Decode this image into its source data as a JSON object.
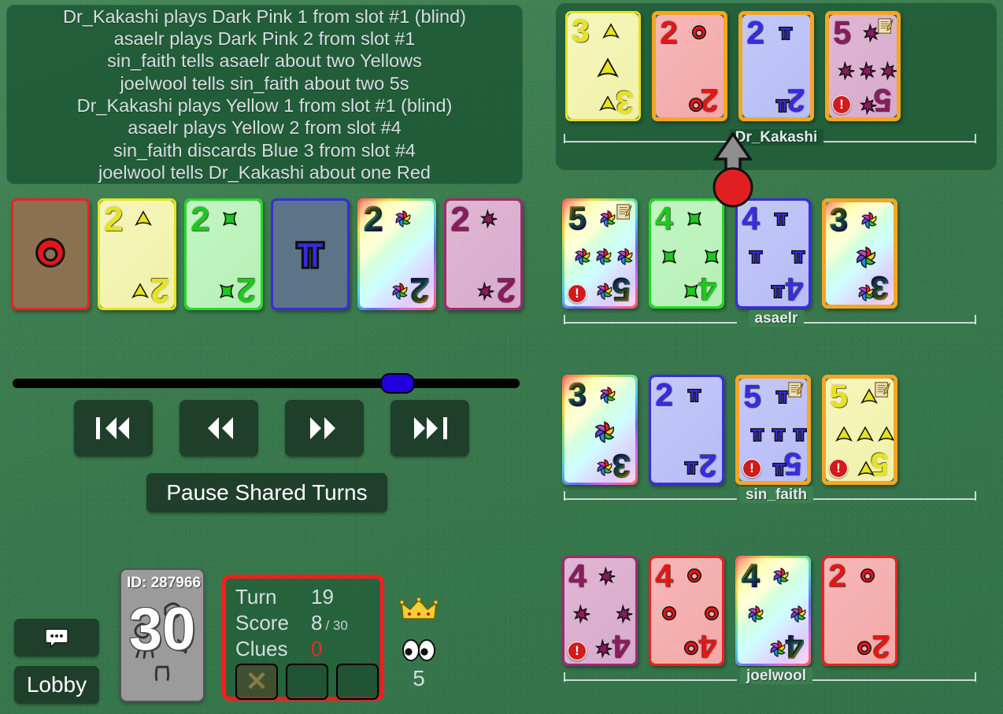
{
  "game": {
    "log": [
      "Dr_Kakashi plays Dark Pink 1 from slot #1 (blind)",
      "asaelr plays Dark Pink 2 from slot #1",
      "sin_faith tells asaelr about two Yellows",
      "joelwool tells sin_faith about two 5s",
      "Dr_Kakashi plays Yellow 1 from slot #1 (blind)",
      "asaelr plays Yellow 2 from slot #4",
      "sin_faith discards Blue 3 from slot #4",
      "joelwool tells Dr_Kakashi about one Red"
    ],
    "play_stacks": [
      {
        "suit": "red",
        "rank": "",
        "empty": true
      },
      {
        "suit": "yellow",
        "rank": "2",
        "empty": false
      },
      {
        "suit": "green",
        "rank": "2",
        "empty": false
      },
      {
        "suit": "blue",
        "rank": "",
        "empty": true
      },
      {
        "suit": "rainbow",
        "rank": "2",
        "empty": false
      },
      {
        "suit": "pink",
        "rank": "2",
        "empty": false
      }
    ],
    "playback": {
      "slider_position_percent": 76,
      "buttons": [
        {
          "name": "go-to-start",
          "icon": "skip-back-icon"
        },
        {
          "name": "rewind",
          "icon": "rewind-icon"
        },
        {
          "name": "fast-forward",
          "icon": "fast-forward-icon"
        },
        {
          "name": "go-to-end",
          "icon": "skip-forward-icon"
        }
      ],
      "pause_label": "Pause Shared Turns"
    },
    "bottom_buttons": {
      "chat_icon": "chat-bubble-icon",
      "lobby_label": "Lobby"
    },
    "deck": {
      "id_label": "ID: 287966",
      "cards_left": "30"
    },
    "status": {
      "turn_label": "Turn",
      "turn_value": "19",
      "score_label": "Score",
      "score_value": "8",
      "score_max": "/ 30",
      "clues_label": "Clues",
      "clues_value": "0",
      "strikes": [
        true,
        false,
        false
      ]
    },
    "spectators": {
      "crown_icon": "crown-icon",
      "eyes_icon": "eyes-icon",
      "count": "5"
    },
    "turn_marker": {
      "icon": "turn-arrow-icon",
      "active_player": "Dr_Kakashi"
    },
    "players": [
      {
        "name": "Dr_Kakashi",
        "active": true,
        "cards": [
          {
            "suit": "yellow",
            "rank": "3",
            "clued": false,
            "note": false,
            "critical": false
          },
          {
            "suit": "red",
            "rank": "2",
            "clued": true,
            "note": false,
            "critical": false
          },
          {
            "suit": "blue",
            "rank": "2",
            "clued": true,
            "note": false,
            "critical": false
          },
          {
            "suit": "pink",
            "rank": "5",
            "clued": true,
            "note": true,
            "critical": true
          }
        ]
      },
      {
        "name": "asaelr",
        "active": false,
        "cards": [
          {
            "suit": "rainbow",
            "rank": "5",
            "clued": false,
            "note": true,
            "critical": true
          },
          {
            "suit": "green",
            "rank": "4",
            "clued": false,
            "note": false,
            "critical": false
          },
          {
            "suit": "blue",
            "rank": "4",
            "clued": false,
            "note": false,
            "critical": false
          },
          {
            "suit": "rainbow",
            "rank": "3",
            "clued": true,
            "note": false,
            "critical": false
          }
        ]
      },
      {
        "name": "sin_faith",
        "active": false,
        "cards": [
          {
            "suit": "rainbow",
            "rank": "3",
            "clued": false,
            "note": false,
            "critical": false
          },
          {
            "suit": "blue",
            "rank": "2",
            "clued": false,
            "note": false,
            "critical": false
          },
          {
            "suit": "blue",
            "rank": "5",
            "clued": true,
            "note": true,
            "critical": true
          },
          {
            "suit": "yellow",
            "rank": "5",
            "clued": true,
            "note": true,
            "critical": true
          }
        ]
      },
      {
        "name": "joelwool",
        "active": false,
        "cards": [
          {
            "suit": "pink",
            "rank": "4",
            "clued": false,
            "note": false,
            "critical": true
          },
          {
            "suit": "red",
            "rank": "4",
            "clued": false,
            "note": false,
            "critical": false
          },
          {
            "suit": "rainbow",
            "rank": "4",
            "clued": false,
            "note": false,
            "critical": false
          },
          {
            "suit": "red",
            "rank": "2",
            "clued": false,
            "note": false,
            "critical": false
          }
        ]
      }
    ]
  }
}
